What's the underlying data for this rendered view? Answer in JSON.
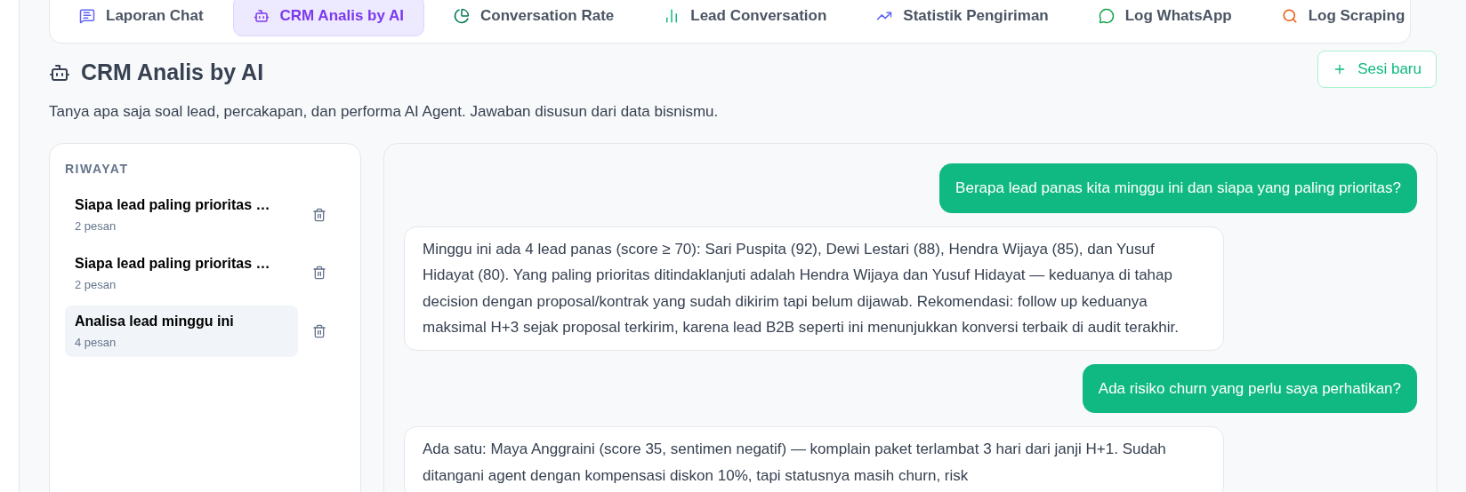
{
  "tabs": [
    {
      "label": "Laporan Chat",
      "kind": "chat",
      "selected": false
    },
    {
      "label": "CRM Analis by AI",
      "kind": "bot",
      "selected": true
    },
    {
      "label": "Conversation Rate",
      "kind": "pie",
      "selected": false
    },
    {
      "label": "Lead Conversation",
      "kind": "bars",
      "selected": false
    },
    {
      "label": "Statistik Pengiriman",
      "kind": "trend",
      "selected": false
    },
    {
      "label": "Log WhatsApp",
      "kind": "whatsapp",
      "selected": false
    },
    {
      "label": "Log Scraping",
      "kind": "search",
      "selected": false
    }
  ],
  "header": {
    "title": "CRM Analis by AI",
    "subtitle": "Tanya apa saja soal lead, percakapan, dan performa AI Agent. Jawaban disusun dari data bisnismu.",
    "new_session_button": "Sesi baru"
  },
  "history": {
    "heading": "RIWAYAT",
    "items": [
      {
        "title": "Siapa lead paling prioritas …",
        "count": "2 pesan",
        "selected": false
      },
      {
        "title": "Siapa lead paling prioritas …",
        "count": "2 pesan",
        "selected": false
      },
      {
        "title": "Analisa lead minggu ini",
        "count": "4 pesan",
        "selected": true
      }
    ]
  },
  "messages": [
    {
      "kind": "user",
      "text": "Berapa lead panas kita minggu ini dan siapa yang paling prioritas?"
    },
    {
      "kind": "assistant",
      "text": "Minggu ini ada 4 lead panas (score ≥ 70): Sari Puspita (92), Dewi Lestari (88), Hendra Wijaya (85), dan Yusuf Hidayat (80). Yang paling prioritas ditindaklanjuti adalah Hendra Wijaya dan Yusuf Hidayat — keduanya di tahap decision dengan proposal/kontrak yang sudah dikirim tapi belum dijawab. Rekomendasi: follow up keduanya maksimal H+3 sejak proposal terkirim, karena lead B2B seperti ini menunjukkan konversi terbaik di audit terakhir."
    },
    {
      "kind": "user",
      "text": "Ada risiko churn yang perlu saya perhatikan?"
    },
    {
      "kind": "assistant",
      "text": "Ada satu: Maya Anggraini (score 35, sentimen negatif) — komplain paket terlambat 3 hari dari janji H+1. Sudah ditangani agent dengan kompensasi diskon 10%, tapi statusnya masih churn, risk"
    }
  ]
}
